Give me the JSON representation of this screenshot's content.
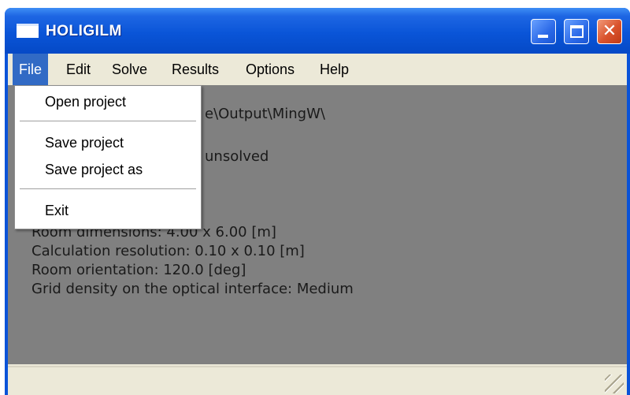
{
  "window": {
    "title": "HOLIGILM",
    "caption": {
      "minimize_icon": "minimize-icon",
      "maximize_icon": "maximize-icon",
      "close_glyph": "✕"
    }
  },
  "menubar": {
    "file": "File",
    "edit": "Edit",
    "solve": "Solve",
    "results": "Results",
    "options": "Options",
    "help": "Help"
  },
  "file_menu": {
    "open": "Open project",
    "save": "Save project",
    "save_as": "Save project as",
    "exit": "Exit"
  },
  "content": {
    "path_fragment": "e\\Output\\MingW\\",
    "state_fragment": "unsolved",
    "lines": [
      "Room dimensions: 4.00 x 6.00 [m]",
      "Calculation resolution: 0.10 x 0.10 [m]",
      "Room orientation: 120.0 [deg]",
      "Grid density on the optical interface: Medium"
    ]
  },
  "colors": {
    "titlebar": "#0a55d8",
    "menu_highlight": "#316ac5",
    "close_button": "#d9522c",
    "content_background": "#808080"
  }
}
